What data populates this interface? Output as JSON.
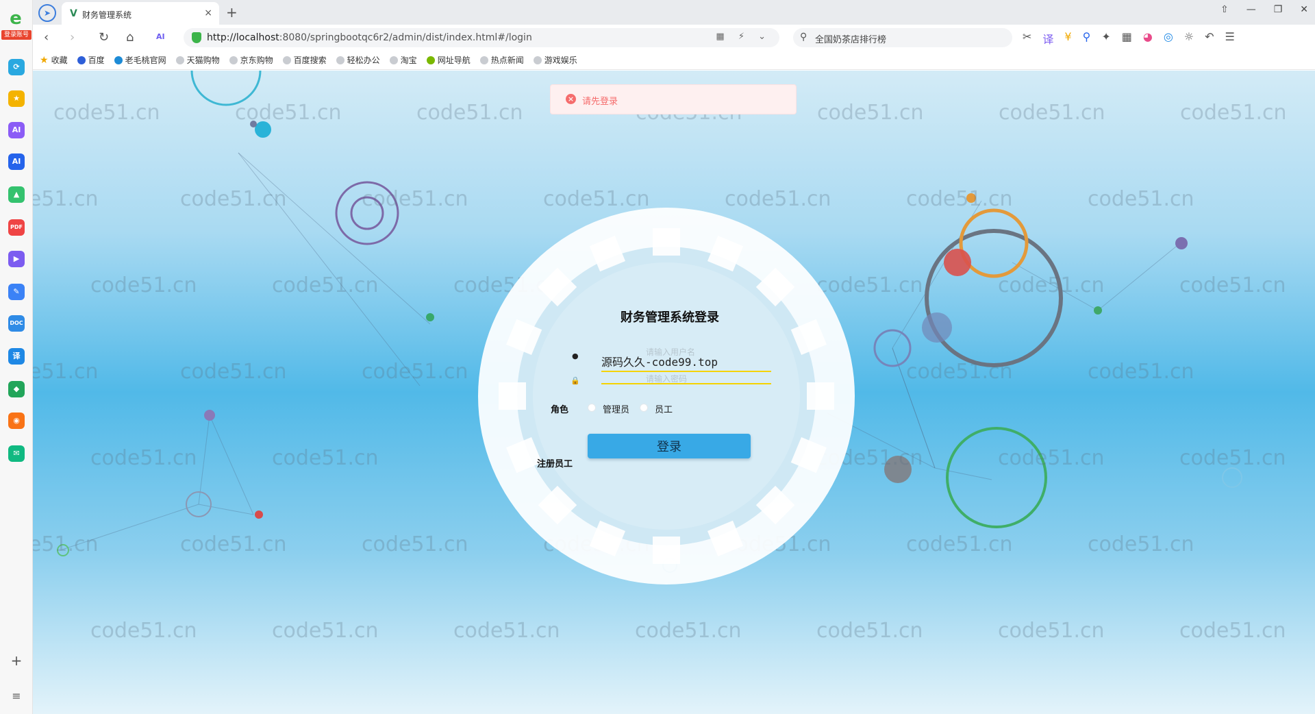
{
  "sidebar": {
    "login_tag": "登录账号",
    "logo_glyph": "e",
    "icons": [
      {
        "name": "translate-icon",
        "glyph": "⟳",
        "color": "#29a8e0"
      },
      {
        "name": "favorites-icon",
        "glyph": "★",
        "color": "#f4b300"
      },
      {
        "name": "ai-assistant-icon",
        "glyph": "AI",
        "color": "#8b5cf6"
      },
      {
        "name": "ai-writing-icon",
        "glyph": "AI",
        "color": "#2563eb"
      },
      {
        "name": "image-icon",
        "glyph": "▲",
        "color": "#34c26e"
      },
      {
        "name": "pdf-icon",
        "glyph": "PDF",
        "color": "#ef4444"
      },
      {
        "name": "video-icon",
        "glyph": "▶",
        "color": "#7c5cf0"
      },
      {
        "name": "notes-icon",
        "glyph": "✎",
        "color": "#3b82f6"
      },
      {
        "name": "doc-icon",
        "glyph": "DOC",
        "color": "#2f8be6"
      },
      {
        "name": "translate-service-icon",
        "glyph": "译",
        "color": "#1e88e5"
      },
      {
        "name": "game-icon",
        "glyph": "◆",
        "color": "#22a55a"
      },
      {
        "name": "weibo-icon",
        "glyph": "◉",
        "color": "#f97316"
      },
      {
        "name": "mail-icon",
        "glyph": "✉",
        "color": "#10b981"
      }
    ],
    "add_glyph": "+",
    "menu_glyph": "≡"
  },
  "tabs": {
    "active_title": "财务管理系统",
    "nav_glyph": "➤",
    "close_glyph": "×",
    "add_glyph": "+",
    "window_controls": [
      "⇧",
      "—",
      "❐",
      "✕"
    ]
  },
  "navbar": {
    "back": "‹",
    "forward": "›",
    "reload": "↻",
    "home": "⌂",
    "ai": "AI",
    "url_host": "http://localhost",
    "url_path": ":8080/springbootqc6r2/admin/dist/index.html#/login",
    "url_extras": "▦ ⚡ ⌄",
    "search_icon": "⚲",
    "search_query": "全国奶茶店排行榜",
    "tools": [
      "✂",
      "译",
      "¥",
      "⚲",
      "✦",
      "▦",
      "◕",
      "◎",
      "☼",
      "↶",
      "☰"
    ]
  },
  "bookmarks": [
    {
      "label": "收藏",
      "icon": "star-icon"
    },
    {
      "label": "百度",
      "icon": "baidu-icon"
    },
    {
      "label": "老毛桃官网",
      "icon": "site-icon"
    },
    {
      "label": "天猫购物",
      "icon": "site-icon"
    },
    {
      "label": "京东购物",
      "icon": "site-icon"
    },
    {
      "label": "百度搜索",
      "icon": "site-icon"
    },
    {
      "label": "轻松办公",
      "icon": "site-icon"
    },
    {
      "label": "淘宝",
      "icon": "site-icon"
    },
    {
      "label": "网址导航",
      "icon": "site-icon"
    },
    {
      "label": "热点新闻",
      "icon": "site-icon"
    },
    {
      "label": "游戏娱乐",
      "icon": "site-icon"
    }
  ],
  "watermark_text": "code51.cn",
  "alert": {
    "icon": "×",
    "message": "请先登录"
  },
  "login": {
    "title": "财务管理系统登录",
    "user_icon": "●",
    "lock_icon": "🔒",
    "username_placeholder": "请输入用户名",
    "username_value": "源码久久-code99.top",
    "password_placeholder": "请输入密码",
    "role_label": "角色",
    "roles": [
      "管理员",
      "员工"
    ],
    "submit_label": "登录",
    "register_link": "注册员工"
  },
  "colors": {
    "accent": "#38a9e6",
    "error": "#f56c6c",
    "underline": "#f5d300"
  }
}
